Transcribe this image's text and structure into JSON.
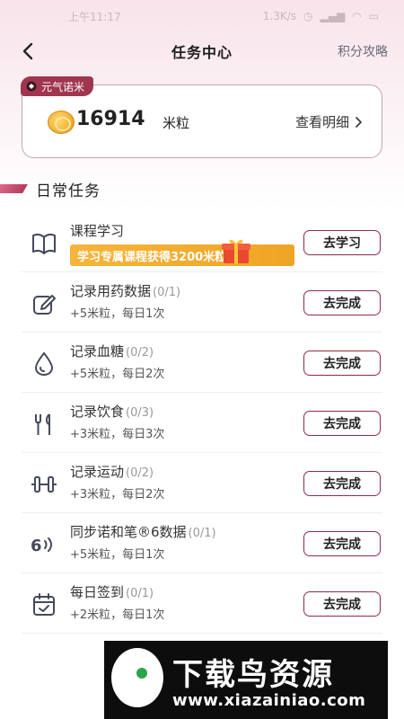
{
  "status_bar": {
    "time": "上午11:17",
    "network_speed": "1.3K/s"
  },
  "header": {
    "title": "任务中心",
    "right_link": "积分攻略"
  },
  "points_card": {
    "tag": "元气诺米",
    "value": "16914",
    "unit": "米粒",
    "detail_link": "查看明细"
  },
  "section": {
    "title": "日常任务"
  },
  "tasks": [
    {
      "icon": "book-icon",
      "name": "课程学习",
      "progress": "",
      "promo": "学习专属课程获得3200米粒",
      "reward": "",
      "button": "去学习"
    },
    {
      "icon": "pencil-icon",
      "name": "记录用药数据",
      "progress": "(0/1)",
      "reward": "+5米粒，每日1次",
      "button": "去完成"
    },
    {
      "icon": "blood-drop-icon",
      "name": "记录血糖",
      "progress": "(0/2)",
      "reward": "+5米粒，每日2次",
      "button": "去完成"
    },
    {
      "icon": "fork-knife-icon",
      "name": "记录饮食",
      "progress": "(0/3)",
      "reward": "+3米粒，每日3次",
      "button": "去完成"
    },
    {
      "icon": "dumbbell-icon",
      "name": "记录运动",
      "progress": "(0/2)",
      "reward": "+3米粒，每日2次",
      "button": "去完成"
    },
    {
      "icon": "sync-pen-icon",
      "name": "同步诺和笔®6数据",
      "progress": "(0/1)",
      "reward": "+5米粒，每日1次",
      "button": "去完成"
    },
    {
      "icon": "calendar-check-icon",
      "name": "每日签到",
      "progress": "(0/1)",
      "reward": "+2米粒，每日1次",
      "button": "去完成"
    }
  ],
  "watermark": {
    "title": "下载鸟资源",
    "url": "www.xiazainiao.com"
  },
  "colors": {
    "accent": "#8e2c45",
    "tag_bg": "#a0354f",
    "promo_bg": "#f2ab2e"
  }
}
